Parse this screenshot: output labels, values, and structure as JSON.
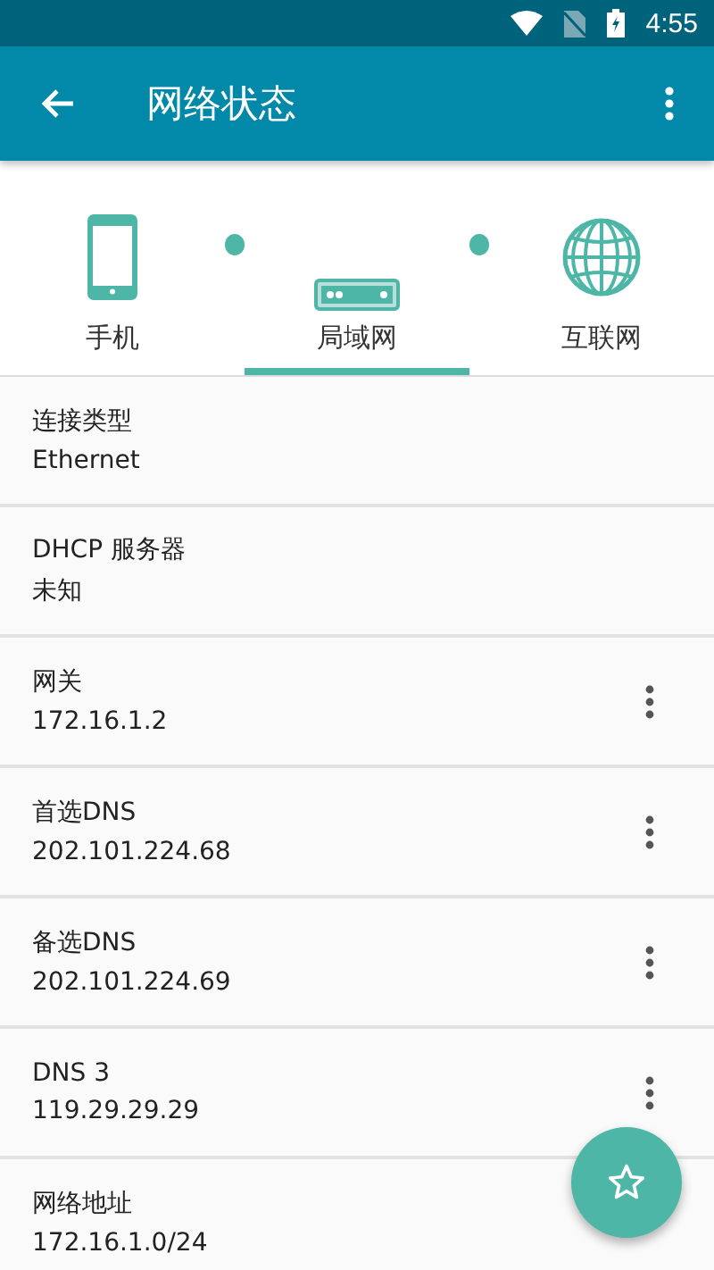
{
  "status_bar": {
    "time": "4:55"
  },
  "app_bar": {
    "title": "网络状态"
  },
  "tabs": [
    {
      "label": "手机",
      "kind": "phone",
      "selected": false
    },
    {
      "label": "局域网",
      "kind": "lan",
      "selected": true
    },
    {
      "label": "互联网",
      "kind": "globe",
      "selected": false
    }
  ],
  "rows": [
    {
      "label": "连接类型",
      "value": "Ethernet",
      "has_menu": false
    },
    {
      "label": "DHCP 服务器",
      "value": "未知",
      "has_menu": false
    },
    {
      "label": "网关",
      "value": "172.16.1.2",
      "has_menu": true
    },
    {
      "label": "首选DNS",
      "value": "202.101.224.68",
      "has_menu": true
    },
    {
      "label": "备选DNS",
      "value": "202.101.224.69",
      "has_menu": true
    },
    {
      "label": "DNS 3",
      "value": "119.29.29.29",
      "has_menu": true
    },
    {
      "label": "网络地址",
      "value": "172.16.1.0/24",
      "has_menu": false
    }
  ]
}
